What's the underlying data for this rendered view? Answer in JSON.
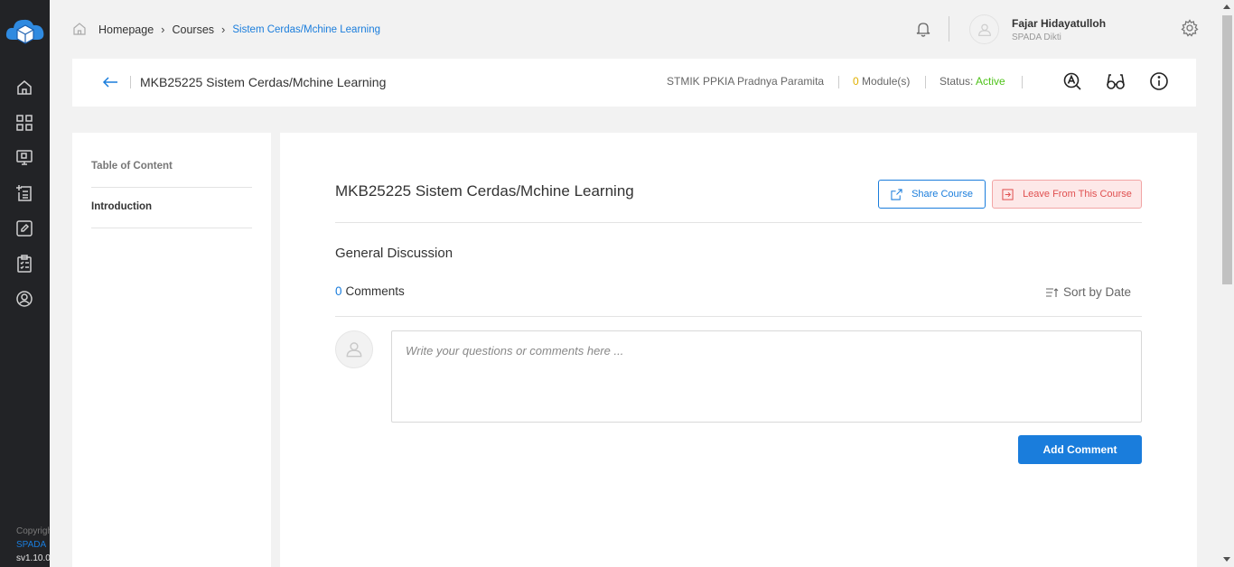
{
  "breadcrumb": {
    "items": [
      "Homepage",
      "Courses"
    ],
    "current": "Sistem Cerdas/Mchine Learning"
  },
  "user": {
    "name": "Fajar Hidayatulloh",
    "subtitle": "SPADA Dikti"
  },
  "course_bar": {
    "title": "MKB25225 Sistem Cerdas/Mchine Learning",
    "institution": "STMIK PPKIA Pradnya Paramita",
    "module_count": "0",
    "module_label": "Module(s)",
    "status_label": "Status:",
    "status_value": "Active"
  },
  "toc": {
    "heading": "Table of Content",
    "items": [
      "Introduction"
    ]
  },
  "main": {
    "title": "MKB25225 Sistem Cerdas/Mchine Learning",
    "share_label": "Share Course",
    "leave_label": "Leave From This Course",
    "discussion_title": "General Discussion",
    "comment_count": "0",
    "comments_label": "Comments",
    "sort_label": "Sort by Date",
    "comment_placeholder": "Write your questions or comments here ...",
    "add_comment_label": "Add Comment"
  },
  "sidebar_footer": {
    "copyright": "Copyright",
    "brand": "SPADA",
    "version": "sv1.10.0"
  },
  "colors": {
    "sidebar_bg": "#222326",
    "accent": "#1a7ddc",
    "status_active": "#4fc21a",
    "module_count": "#e0b000",
    "leave_text": "#e05050"
  },
  "icons": {
    "sidebar": [
      "home-icon",
      "grid-icon",
      "video-icon",
      "add-list-icon",
      "edit-icon",
      "clipboard-icon",
      "user-circle-icon"
    ],
    "course_bar": [
      "accessibility-icon",
      "glasses-icon",
      "info-icon"
    ]
  }
}
